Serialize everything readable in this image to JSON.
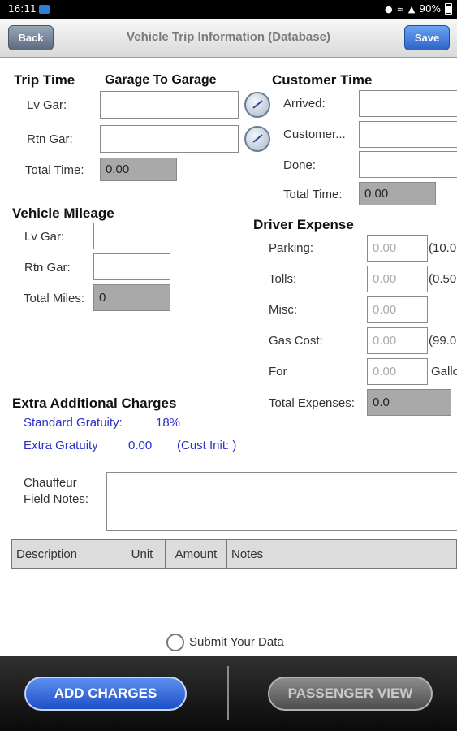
{
  "status_bar": {
    "time": "16:11",
    "battery": "90%"
  },
  "nav": {
    "back_label": "Back",
    "title": "Vehicle Trip Information (Database)",
    "save_label": "Save"
  },
  "trip_time": {
    "heading": "Trip Time",
    "subheading": "Garage To Garage",
    "lv_gar_label": "Lv Gar:",
    "lv_gar_value": "",
    "rtn_gar_label": "Rtn Gar:",
    "rtn_gar_value": "",
    "total_label": "Total Time:",
    "total_value": "0.00"
  },
  "customer_time": {
    "heading": "Customer Time",
    "arrived_label": "Arrived:",
    "arrived_value": "",
    "customer_label": "Customer...",
    "customer_value": "",
    "done_label": "Done:",
    "done_value": "",
    "total_label": "Total Time:",
    "total_value": "0.00"
  },
  "vehicle_mileage": {
    "heading": "Vehicle Mileage",
    "lv_gar_label": "Lv Gar:",
    "lv_gar_value": "",
    "rtn_gar_label": "Rtn Gar:",
    "rtn_gar_value": "",
    "total_label": "Total Miles:",
    "total_value": "0"
  },
  "driver_expense": {
    "heading": "Driver Expense",
    "parking_label": "Parking:",
    "parking_value": "0.00",
    "parking_note": "(10.0",
    "tolls_label": "Tolls:",
    "tolls_value": "0.00",
    "tolls_note": "(0.50",
    "misc_label": "Misc:",
    "misc_value": "0.00",
    "gas_label": "Gas Cost:",
    "gas_value": "0.00",
    "gas_note": "(99.0",
    "for_label": "For",
    "for_value": "0.00",
    "for_note": "Gallo",
    "total_label": "Total Expenses:",
    "total_value": "0.0"
  },
  "extra_charges": {
    "heading": "Extra Additional Charges",
    "standard_gratuity_label": "Standard Gratuity:",
    "standard_gratuity_value": "18%",
    "extra_gratuity_label": "Extra Gratuity",
    "extra_gratuity_value": "0.00",
    "cust_init": "(Cust Init: )"
  },
  "field_notes": {
    "label": "Chauffeur\nField Notes:",
    "value": ""
  },
  "charges_table": {
    "columns": [
      "Description",
      "Unit",
      "Amount",
      "Notes"
    ]
  },
  "submit": {
    "label": "Submit Your Data",
    "checked": false
  },
  "bottom": {
    "add_charges_label": "ADD CHARGES",
    "passenger_view_label": "PASSENGER VIEW"
  },
  "colors": {
    "accent_blue": "#2b66c9",
    "link_blue": "#2a2ec4",
    "calc_gray": "#a9a9a9"
  }
}
